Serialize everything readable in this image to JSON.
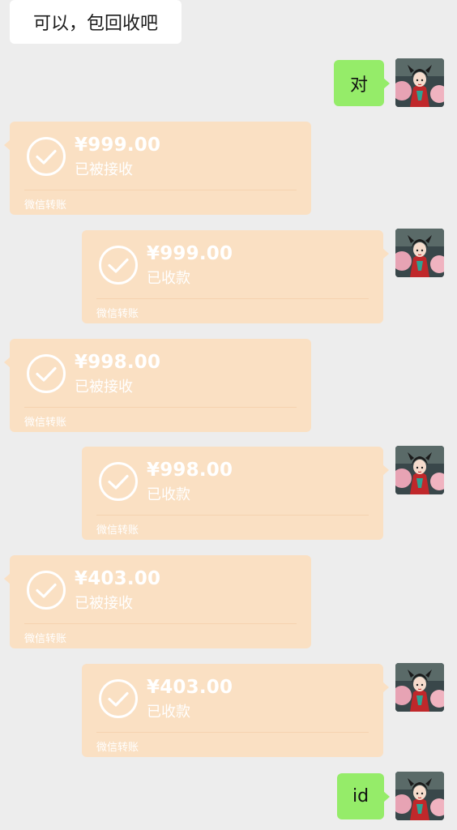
{
  "messages": {
    "received_text": "可以，包回收吧",
    "sent_1": "对",
    "sent_last": "id"
  },
  "transfers": [
    {
      "amount": "¥999.00",
      "status": "已被接收",
      "footer": "微信转账"
    },
    {
      "amount": "¥999.00",
      "status": "已收款",
      "footer": "微信转账"
    },
    {
      "amount": "¥998.00",
      "status": "已被接收",
      "footer": "微信转账"
    },
    {
      "amount": "¥998.00",
      "status": "已收款",
      "footer": "微信转账"
    },
    {
      "amount": "¥403.00",
      "status": "已被接收",
      "footer": "微信转账"
    },
    {
      "amount": "¥403.00",
      "status": "已收款",
      "footer": "微信转账"
    }
  ],
  "icons": {
    "transfer_done": "check-circle-icon",
    "avatar": "user-avatar"
  },
  "colors": {
    "background": "#ededed",
    "sent_bubble": "#95ec69",
    "received_bubble": "#ffffff",
    "transfer_card": "#fae0c3"
  }
}
